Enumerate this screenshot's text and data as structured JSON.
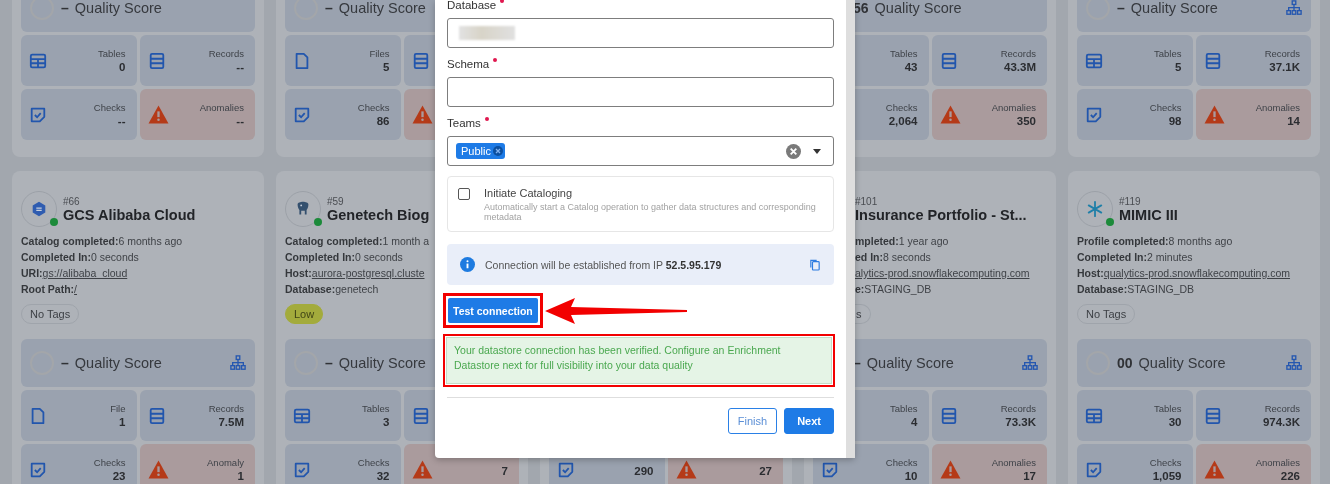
{
  "cards_row_1": [
    {
      "quality": {
        "score": "–",
        "label": "Quality Score",
        "tree": false
      },
      "tiles": [
        {
          "kind": "tables",
          "label": "Tables",
          "value": "0"
        },
        {
          "kind": "records",
          "label": "Records",
          "value": "--"
        },
        {
          "kind": "checks",
          "label": "Checks",
          "value": "--"
        },
        {
          "kind": "anomalies",
          "label": "Anomalies",
          "value": "--"
        }
      ]
    },
    {
      "quality": {
        "score": "–",
        "label": "Quality Score",
        "tree": false
      },
      "tiles": [
        {
          "kind": "files",
          "label": "Files",
          "value": "5"
        },
        {
          "kind": "records"
        },
        {
          "kind": "checks",
          "label": "Checks",
          "value": "86"
        },
        {
          "kind": "anomalies"
        }
      ]
    },
    {
      "quality": {
        "score": "56",
        "label": "Quality Score",
        "tree": false
      },
      "tiles": [
        {
          "kind": "tables",
          "label": "Tables",
          "value": "43"
        },
        {
          "kind": "records",
          "label": "Records",
          "value": "43.3M"
        },
        {
          "kind": "checks",
          "label": "Checks",
          "value": "2,064"
        },
        {
          "kind": "anomalies",
          "label": "Anomalies",
          "value": "350"
        }
      ]
    },
    {
      "quality": {
        "score": "–",
        "label": "Quality Score",
        "tree": true
      },
      "tiles": [
        {
          "kind": "tables",
          "label": "Tables",
          "value": "5"
        },
        {
          "kind": "records",
          "label": "Records",
          "value": "37.1K"
        },
        {
          "kind": "checks",
          "label": "Checks",
          "value": "98"
        },
        {
          "kind": "anomalies",
          "label": "Anomalies",
          "value": "14"
        }
      ]
    }
  ],
  "cards_row_2": [
    {
      "number": "#66",
      "title": "GCS Alibaba Cloud",
      "kind": "gcs",
      "online": true,
      "details": [
        {
          "label": "Catalog completed:",
          "value": "6 months ago"
        },
        {
          "label": "Completed In:",
          "value": "0 seconds"
        },
        {
          "label": "URI:",
          "value": "gs://alibaba_cloud",
          "link": true
        },
        {
          "label": "Root Path:",
          "value": "/",
          "link": true
        }
      ],
      "tag": {
        "label": "No Tags",
        "kind": "none"
      },
      "quality": {
        "score": "–",
        "label": "Quality Score",
        "tree": true
      },
      "tiles": [
        {
          "kind": "files",
          "label": "File",
          "value": "1"
        },
        {
          "kind": "records",
          "label": "Records",
          "value": "7.5M"
        },
        {
          "kind": "checks",
          "label": "Checks",
          "value": "23"
        },
        {
          "kind": "anomalies",
          "label": "Anomaly",
          "value": "1"
        }
      ]
    },
    {
      "number": "#59",
      "title": "Genetech Biog",
      "kind": "postgres",
      "online": true,
      "details": [
        {
          "label": "Catalog completed:",
          "value": "1 month a"
        },
        {
          "label": "Completed In:",
          "value": "0 seconds"
        },
        {
          "label": "Host:",
          "value": "aurora-postgresql.cluste",
          "link": true
        },
        {
          "label": "Database:",
          "value": "genetech"
        }
      ],
      "tag": {
        "label": "Low",
        "kind": "priority"
      },
      "quality": {
        "score": "–",
        "label": "Quality Score",
        "tree": false
      },
      "tiles": [
        {
          "kind": "tables",
          "label": "Tables",
          "value": "3"
        },
        {
          "kind": "records"
        },
        {
          "kind": "checks",
          "label": "Checks",
          "value": "32"
        },
        {
          "kind": "anomalies",
          "value": "7"
        }
      ]
    },
    {
      "tiles": [
        {
          "kind": "checks",
          "value": "290"
        },
        {
          "kind": "anomalies",
          "value": "27"
        }
      ]
    },
    {
      "number": "#101",
      "title": "Insurance Portfolio - St...",
      "details": [
        {
          "label": "mpleted:",
          "value": "1 year ago"
        },
        {
          "label": "ed In:",
          "value": "8 seconds"
        },
        {
          "value": "alytics-prod.snowflakecomputing.com",
          "link": true
        },
        {
          "label": "e:",
          "value": "STAGING_DB"
        }
      ],
      "tag": {
        "label": "s",
        "kind": "none"
      },
      "quality": {
        "score": "–",
        "label": "Quality Score",
        "tree": true
      },
      "tiles": [
        {
          "kind": "tables",
          "label": "Tables",
          "value": "4"
        },
        {
          "kind": "records",
          "label": "Records",
          "value": "73.3K"
        },
        {
          "kind": "checks",
          "label": "Checks",
          "value": "10"
        },
        {
          "kind": "anomalies",
          "label": "Anomalies",
          "value": "17"
        }
      ]
    },
    {
      "number": "#119",
      "title": "MIMIC III",
      "kind": "snowflake",
      "online": true,
      "details": [
        {
          "label": "Profile completed:",
          "value": "8 months ago"
        },
        {
          "label": "Completed In:",
          "value": "2 minutes"
        },
        {
          "label": "Host:",
          "value": "qualytics-prod.snowflakecomputing.com",
          "link": true
        },
        {
          "label": "Database:",
          "value": "STAGING_DB"
        }
      ],
      "tag": {
        "label": "No Tags",
        "kind": "none"
      },
      "quality": {
        "score": "00",
        "label": "Quality Score",
        "tree": true
      },
      "tiles": [
        {
          "kind": "tables",
          "label": "Tables",
          "value": "30"
        },
        {
          "kind": "records",
          "label": "Records",
          "value": "974.3K"
        },
        {
          "kind": "checks",
          "label": "Checks",
          "value": "1,059"
        },
        {
          "kind": "anomalies",
          "label": "Anomalies",
          "value": "226"
        }
      ]
    }
  ],
  "modal": {
    "fields": [
      {
        "kind": "text",
        "label": "Database",
        "required": true,
        "redacted": true
      },
      {
        "kind": "text",
        "label": "Schema",
        "required": true,
        "redacted": false
      },
      {
        "kind": "select",
        "label": "Teams",
        "required": true,
        "chips": [
          "Public"
        ]
      }
    ],
    "cataloging": {
      "label": "Initiate Cataloging",
      "description": "Automatically start a Catalog operation to gather data structures and corresponding metadata",
      "checked": false
    },
    "info": "Connection will be established from IP **52.5.95.179**",
    "test_button": "Test connection",
    "success_message": "Your datastore connection has been verified. Configure an Enrichment Datastore next for full visibility into your data quality",
    "buttons": [
      {
        "label": "Finish",
        "kind": "secondary"
      },
      {
        "label": "Next",
        "kind": "primary"
      }
    ]
  }
}
